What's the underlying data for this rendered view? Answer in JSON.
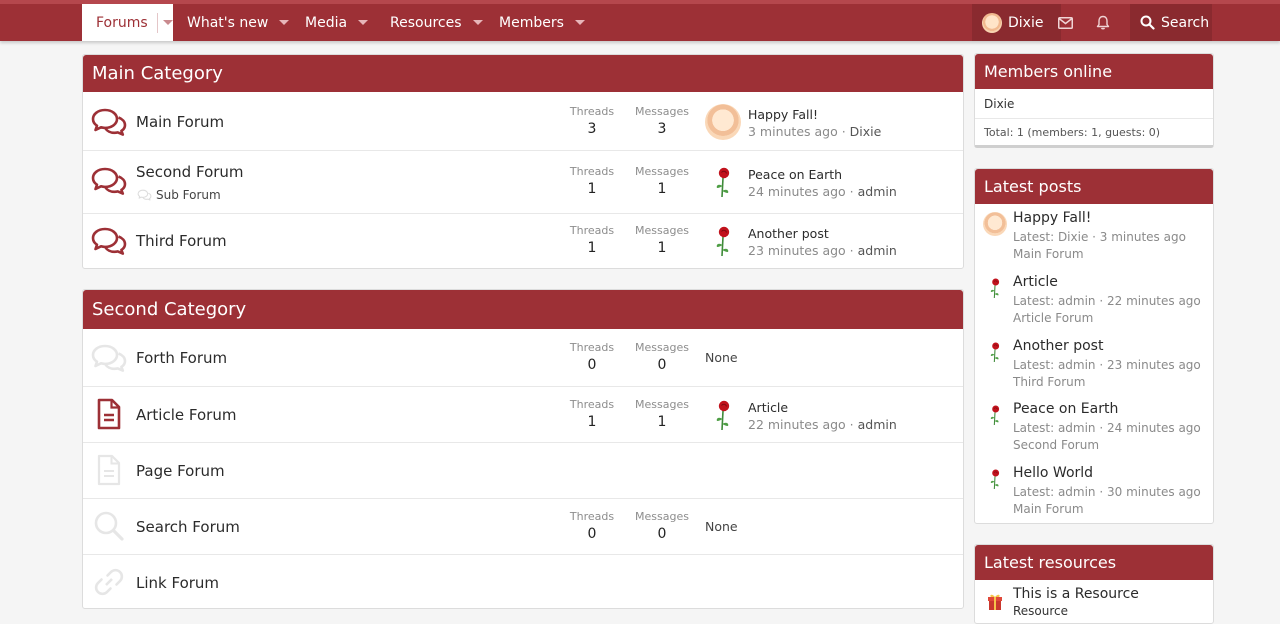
{
  "nav": {
    "tabs": [
      {
        "label": "Forums"
      },
      {
        "label": "What's new"
      },
      {
        "label": "Media"
      },
      {
        "label": "Resources"
      },
      {
        "label": "Members"
      }
    ],
    "user": "Dixie",
    "search": "Search"
  },
  "categories": [
    {
      "title": "Main Category",
      "nodes": [
        {
          "title": "Main Forum",
          "threads_label": "Threads",
          "threads": "3",
          "messages_label": "Messages",
          "messages": "3",
          "last_title": "Happy Fall!",
          "last_time": "3 minutes ago",
          "last_user": "Dixie"
        },
        {
          "title": "Second Forum",
          "sub": "Sub Forum",
          "threads_label": "Threads",
          "threads": "1",
          "messages_label": "Messages",
          "messages": "1",
          "last_title": "Peace on Earth",
          "last_time": "24 minutes ago",
          "last_user": "admin"
        },
        {
          "title": "Third Forum",
          "threads_label": "Threads",
          "threads": "1",
          "messages_label": "Messages",
          "messages": "1",
          "last_title": "Another post",
          "last_time": "23 minutes ago",
          "last_user": "admin"
        }
      ]
    },
    {
      "title": "Second Category",
      "nodes": [
        {
          "title": "Forth Forum",
          "threads_label": "Threads",
          "threads": "0",
          "messages_label": "Messages",
          "messages": "0",
          "none": "None"
        },
        {
          "title": "Article Forum",
          "threads_label": "Threads",
          "threads": "1",
          "messages_label": "Messages",
          "messages": "1",
          "last_title": "Article",
          "last_time": "22 minutes ago",
          "last_user": "admin"
        },
        {
          "title": "Page Forum"
        },
        {
          "title": "Search Forum",
          "threads_label": "Threads",
          "threads": "0",
          "messages_label": "Messages",
          "messages": "0",
          "none": "None"
        },
        {
          "title": "Link Forum"
        }
      ]
    }
  ],
  "sidebar": {
    "members_online": {
      "title": "Members online",
      "member": "Dixie",
      "total": "Total: 1 (members: 1, guests: 0)"
    },
    "latest_posts": {
      "title": "Latest posts",
      "items": [
        {
          "title": "Happy Fall!",
          "meta": "Latest: Dixie · 3 minutes ago",
          "forum": "Main Forum"
        },
        {
          "title": "Article",
          "meta": "Latest: admin · 22 minutes ago",
          "forum": "Article Forum"
        },
        {
          "title": "Another post",
          "meta": "Latest: admin · 23 minutes ago",
          "forum": "Third Forum"
        },
        {
          "title": "Peace on Earth",
          "meta": "Latest: admin · 24 minutes ago",
          "forum": "Second Forum"
        },
        {
          "title": "Hello World",
          "meta": "Latest: admin · 30 minutes ago",
          "forum": "Main Forum"
        }
      ]
    },
    "latest_resources": {
      "title": "Latest resources",
      "items": [
        {
          "title": "This is a Resource",
          "category": "Resource"
        }
      ]
    }
  },
  "colors": {
    "brand": "#9d3036",
    "brand_dark": "#8a2a2f"
  }
}
